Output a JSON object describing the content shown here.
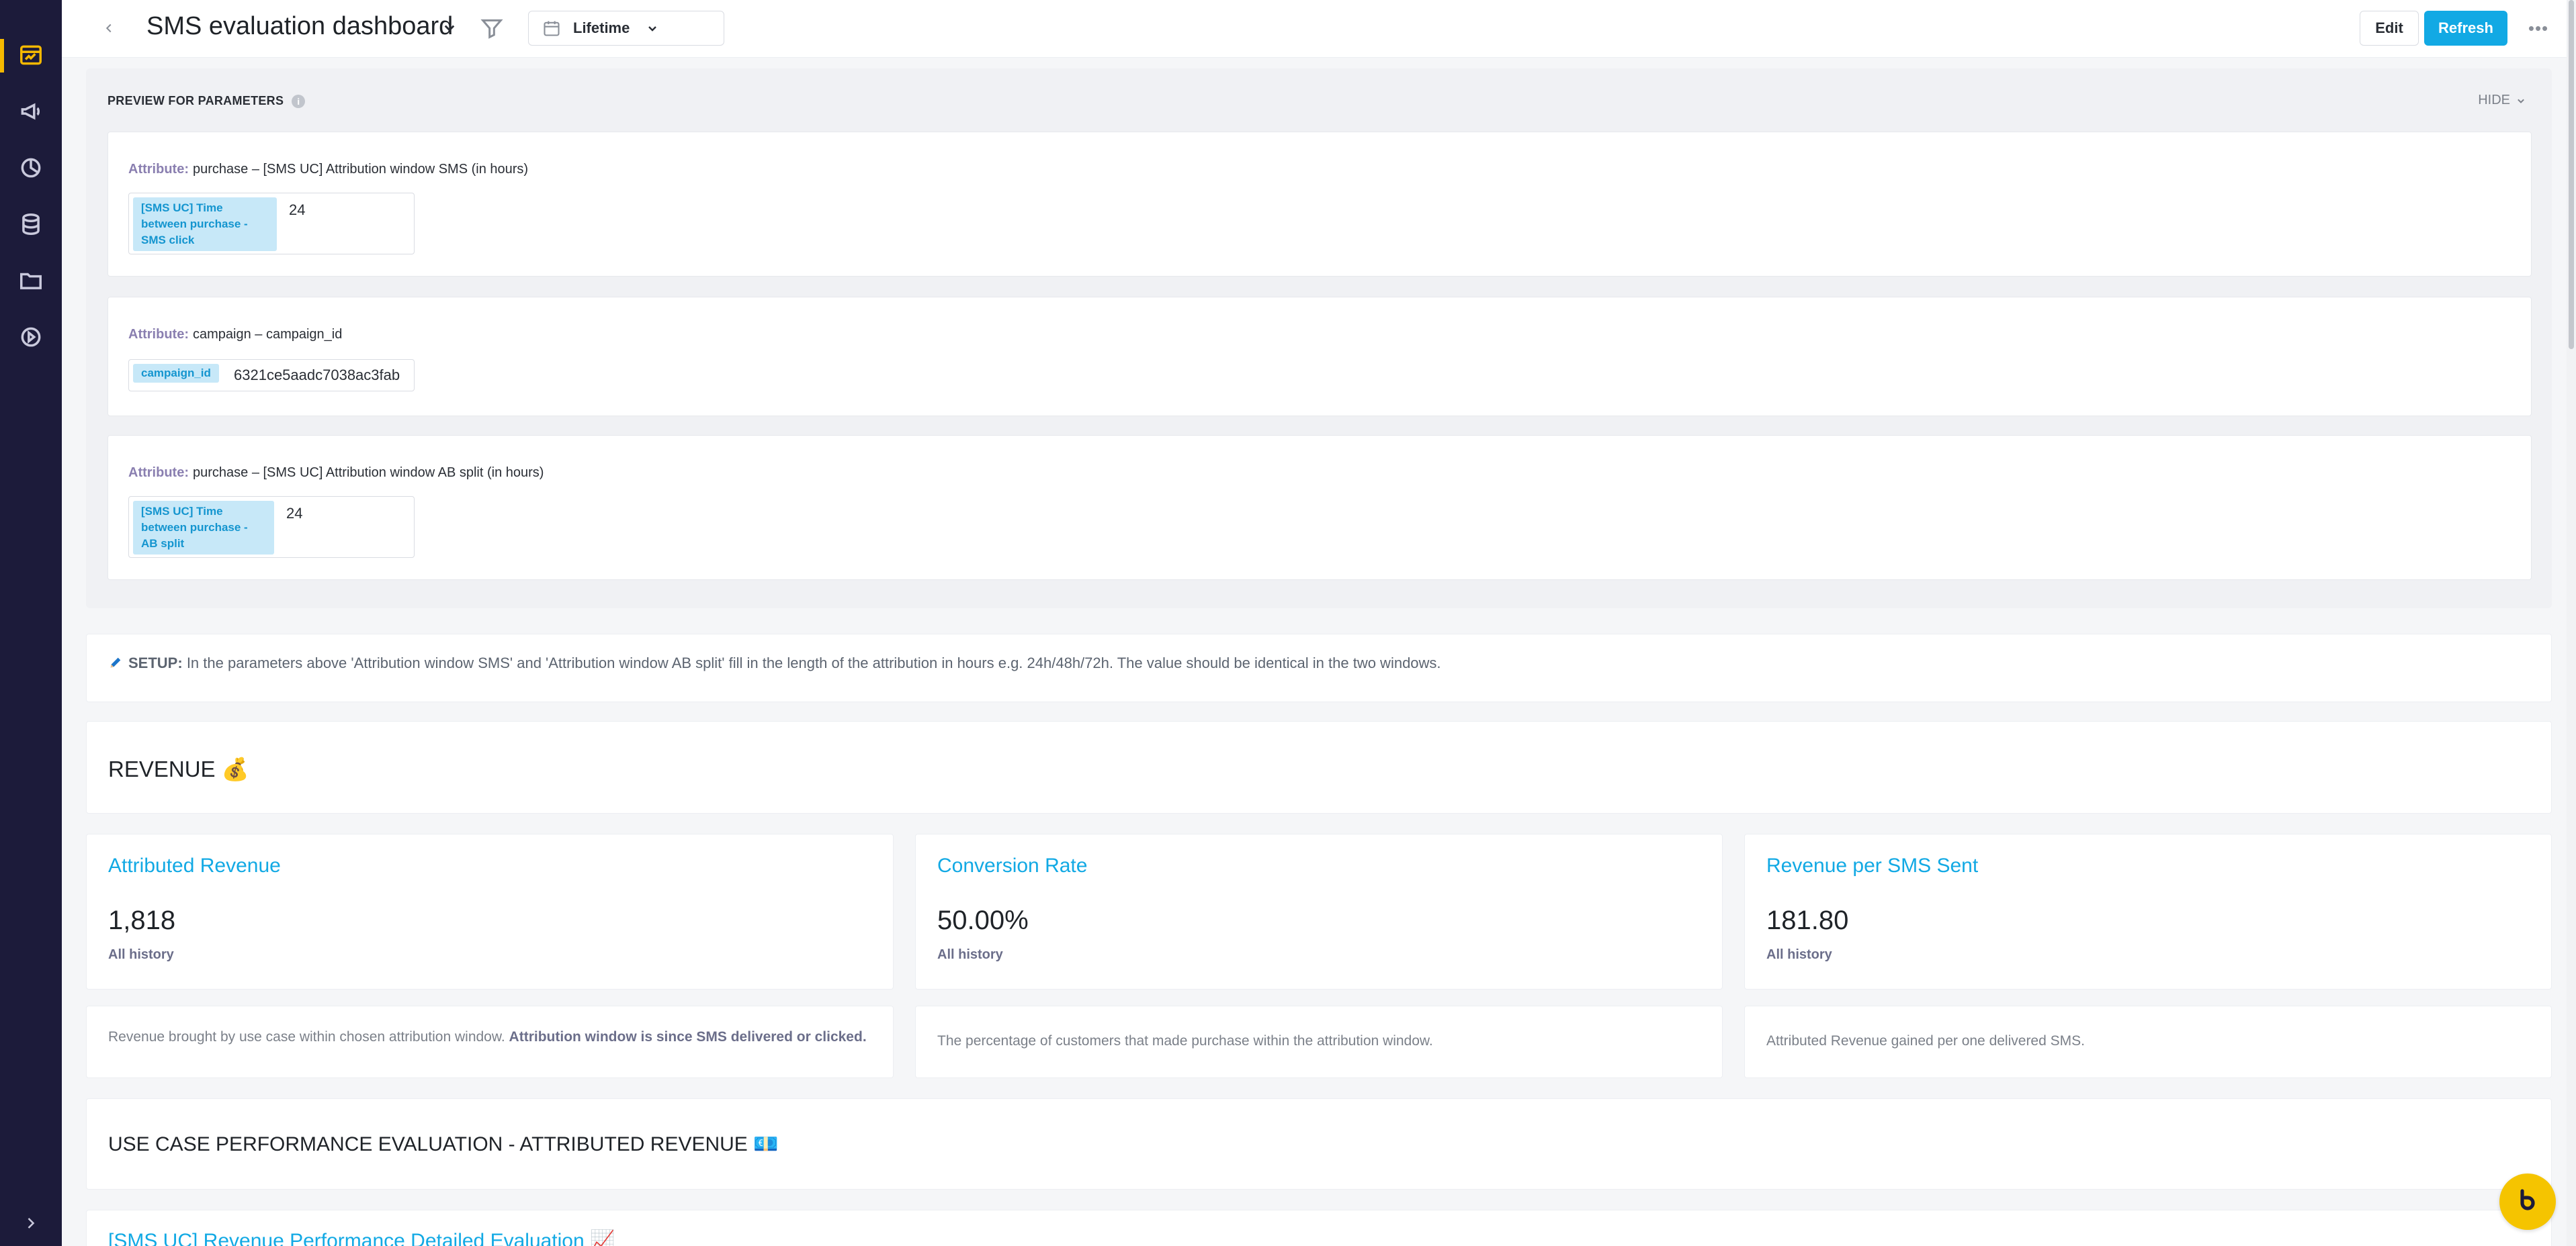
{
  "header": {
    "title": "SMS evaluation dashboard",
    "date_range": "Lifetime",
    "edit_label": "Edit",
    "refresh_label": "Refresh",
    "more_label": "•••"
  },
  "params": {
    "heading": "PREVIEW FOR PARAMETERS",
    "info": "i",
    "hide_label": "HIDE",
    "attr_prefix": "Attribute:",
    "items": [
      {
        "attribute": "purchase – [SMS UC] Attribution window SMS (in hours)",
        "tag": "[SMS UC] Time between purchase - SMS click",
        "value": "24"
      },
      {
        "attribute": "campaign – campaign_id",
        "tag": "campaign_id",
        "value": "6321ce5aadc7038ac3fab"
      },
      {
        "attribute": "purchase – [SMS UC] Attribution window AB split (in hours)",
        "tag": "[SMS UC] Time between purchase - AB split",
        "value": "24"
      }
    ]
  },
  "setup": {
    "label": "SETUP:",
    "text": "In the parameters above 'Attribution window SMS' and 'Attribution window AB split' fill in the length of the attribution in hours e.g. 24h/48h/72h. The value should be identical in the two windows."
  },
  "revenue": {
    "title": "REVENUE 💰",
    "kpis": [
      {
        "title": "Attributed Revenue",
        "value": "1,818",
        "sub": "All history"
      },
      {
        "title": "Conversion Rate",
        "value": "50.00%",
        "sub": "All history"
      },
      {
        "title": "Revenue per SMS Sent",
        "value": "181.80",
        "sub": "All history"
      }
    ],
    "descriptions": [
      {
        "text": "Revenue brought by use case within chosen attribution window.",
        "bold": "Attribution window is since SMS delivered or clicked."
      },
      {
        "text": "The percentage of customers that made purchase within the attribution window.",
        "bold": ""
      },
      {
        "text": "Attributed Revenue gained per one delivered SMS.",
        "bold": ""
      }
    ]
  },
  "evaluation": {
    "title": "USE CASE PERFORMANCE EVALUATION  -  ATTRIBUTED REVENUE 💶",
    "next_title": "[SMS UC] Revenue Performance Detailed Evaluation 📈"
  },
  "colors": {
    "accent": "#12a9e4",
    "sidebar": "#1c1b3a",
    "active_icon": "#f5b800",
    "chat": "#f5c400"
  },
  "icons": {
    "sidebar": [
      "dashboard-icon",
      "megaphone-icon",
      "analytics-icon",
      "database-icon",
      "folder-icon",
      "play-icon",
      "expand-icon"
    ]
  }
}
